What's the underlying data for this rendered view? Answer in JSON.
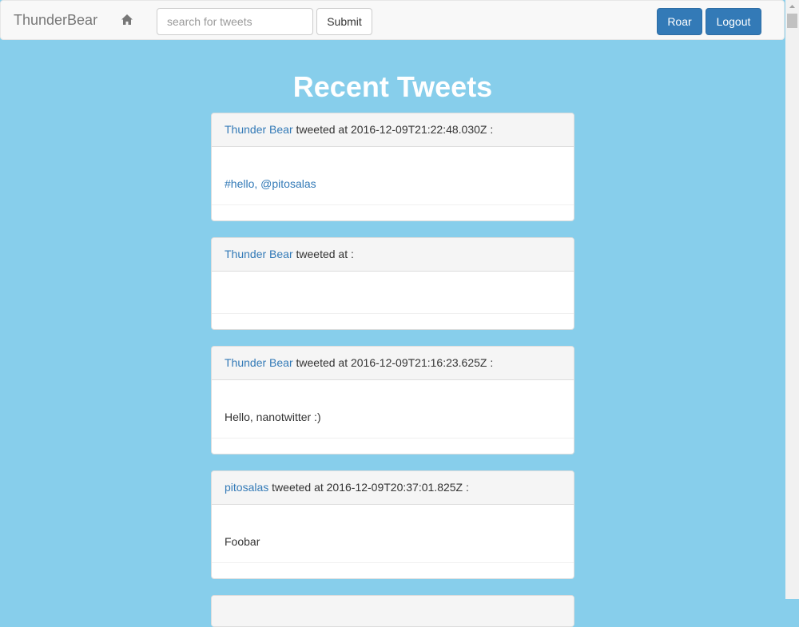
{
  "navbar": {
    "brand": "ThunderBear",
    "search_placeholder": "search for tweets",
    "submit_label": "Submit",
    "roar_label": "Roar",
    "logout_label": "Logout"
  },
  "page": {
    "title": "Recent Tweets"
  },
  "tweets": [
    {
      "author": "Thunder Bear",
      "meta": " tweeted at 2016-12-09T21:22:48.030Z :",
      "hashtag": "#hello",
      "separator": ", ",
      "mention": "@pitosalas"
    },
    {
      "author": "Thunder Bear",
      "meta": " tweeted at :",
      "text": ""
    },
    {
      "author": "Thunder Bear",
      "meta": " tweeted at 2016-12-09T21:16:23.625Z :",
      "text": "Hello, nanotwitter :)"
    },
    {
      "author": "pitosalas",
      "meta": " tweeted at 2016-12-09T20:37:01.825Z :",
      "text": "Foobar"
    }
  ],
  "colors": {
    "background": "#87ceeb",
    "primary": "#337ab7"
  }
}
